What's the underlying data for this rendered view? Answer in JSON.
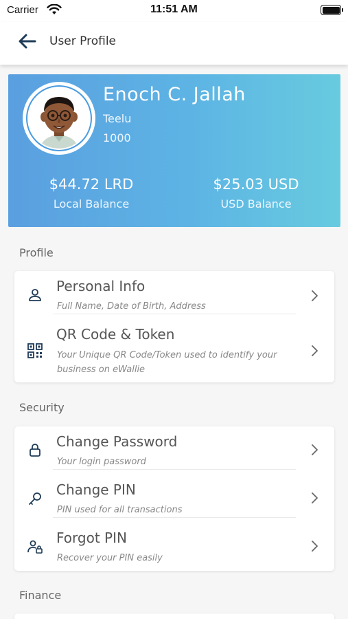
{
  "status_bar": {
    "carrier": "Carrier",
    "time": "11:51 AM"
  },
  "header": {
    "title": "User Profile"
  },
  "profile": {
    "name": "Enoch C. Jallah",
    "subtitle": "Teelu",
    "id": "1000",
    "local_balance": {
      "amount": "$44.72 LRD",
      "label": "Local Balance"
    },
    "usd_balance": {
      "amount": "$25.03 USD",
      "label": "USD Balance"
    }
  },
  "sections": {
    "profile": {
      "title": "Profile",
      "items": [
        {
          "title": "Personal Info",
          "desc": "Full Name, Date of Birth, Address",
          "icon": "user-icon"
        },
        {
          "title": "QR Code & Token",
          "desc": "Your Unique QR Code/Token used to identify your business on eWallie",
          "icon": "qr-code-icon"
        }
      ]
    },
    "security": {
      "title": "Security",
      "items": [
        {
          "title": "Change Password",
          "desc": "Your login password",
          "icon": "lock-icon"
        },
        {
          "title": "Change PIN",
          "desc": "PIN used for all transactions",
          "icon": "key-icon"
        },
        {
          "title": "Forgot PIN",
          "desc": "Recover your PIN easily",
          "icon": "user-lock-icon"
        }
      ]
    },
    "finance": {
      "title": "Finance"
    }
  },
  "colors": {
    "gradient_start": "#5a9fe0",
    "gradient_end": "#68cbdf",
    "icon": "#1f3b57"
  }
}
